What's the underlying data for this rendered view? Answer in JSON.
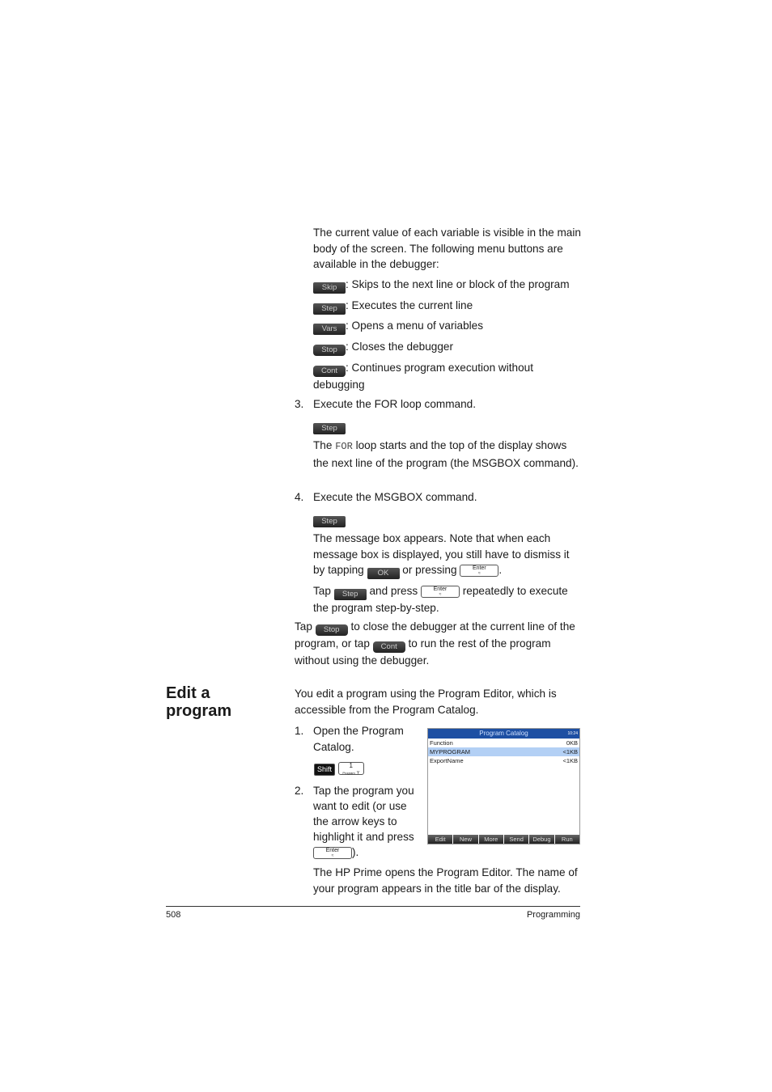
{
  "intro": "The current value of each variable is visible in the main body of the screen. The following menu buttons are available in the debugger:",
  "buttons": [
    {
      "key": "Skip",
      "desc": ": Skips to the next line or block of the program"
    },
    {
      "key": "Step",
      "desc": ": Executes the current line"
    },
    {
      "key": "Vars",
      "desc": ": Opens a menu of variables"
    },
    {
      "key": "Stop",
      "desc": ": Closes the debugger"
    },
    {
      "key": "Cont",
      "desc": ": Continues program execution without debugging"
    }
  ],
  "step3": {
    "num": "3.",
    "text": "Execute the FOR loop command.",
    "key": "Step",
    "p1": "The ",
    "code": "FOR",
    "p2": " loop starts and the top of the display shows the next line of the program (the MSGBOX command)."
  },
  "step4": {
    "num": "4.",
    "text": "Execute the MSGBOX command.",
    "key": "Step",
    "p1": "The message box appears. Note that when each message box is displayed, you still have to dismiss it by tapping ",
    "ok": "OK",
    "p2": " or pressing ",
    "p3": ".",
    "t1": "Tap ",
    "t2": " and press ",
    "t3": " repeatedly to execute the program step-by-step."
  },
  "enter_key": {
    "label": "Enter",
    "sub": "≈"
  },
  "closing": {
    "a": "Tap ",
    "stop": "Stop",
    "b": " to close the debugger at the current line of the program, or tap ",
    "cont": "Cont",
    "c": " to run the rest of the program without using the debugger."
  },
  "section": {
    "title_line1": "Edit a",
    "title_line2": "program",
    "intro": "You edit a program using the Program Editor, which is accessible from the Program Catalog."
  },
  "edit_steps": [
    {
      "num": "1.",
      "text": "Open the Program Catalog.",
      "keys": {
        "shift": "Shift",
        "one": "1",
        "one_sub": "Program",
        "one_alt": "Y"
      }
    },
    {
      "num": "2.",
      "text1": "Tap the program you want to edit (or use the arrow keys to highlight it and press ",
      "text2": ")."
    }
  ],
  "calc": {
    "title": "Program Catalog",
    "status": "10:24",
    "rows": [
      {
        "name": "Function",
        "size": "0KB"
      },
      {
        "name": "MYPROGRAM",
        "size": "<1KB",
        "selected": true
      },
      {
        "name": "ExportName",
        "size": "<1KB"
      }
    ],
    "menu": [
      "Edit",
      "New",
      "More",
      "Send",
      "Debug",
      "Run"
    ],
    "title_color": "#1d4fa3",
    "highlight_color": "#b3d0f5"
  },
  "outro": "The HP Prime opens the Program Editor. The name of your program appears in the title bar of the display.",
  "footer": {
    "page": "508",
    "chapter": "Programming"
  }
}
